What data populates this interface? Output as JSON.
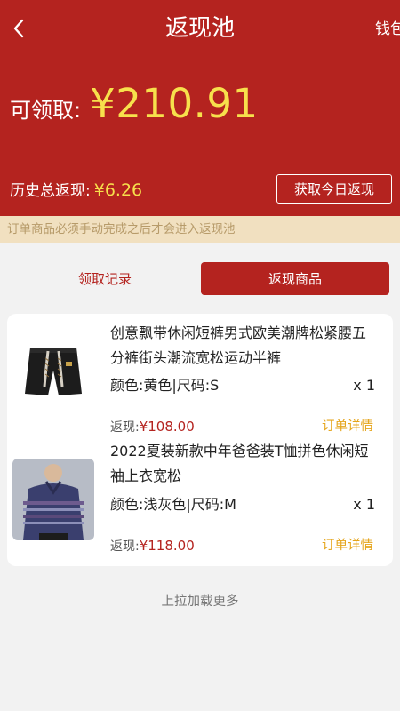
{
  "header": {
    "title": "返现池",
    "right_label": "钱包"
  },
  "summary": {
    "available_label": "可领取:",
    "available_amount": "¥210.91",
    "history_label": "历史总返现:",
    "history_amount": "¥6.26",
    "today_button": "获取今日返现"
  },
  "notice": "订单商品必须手动完成之后才会进入返现池",
  "tabs": [
    {
      "label": "领取记录",
      "active": false
    },
    {
      "label": "返现商品",
      "active": true
    }
  ],
  "products": [
    {
      "title": "创意飘带休闲短裤男式欧美潮牌松紧腰五分裤街头潮流宽松运动半裤",
      "spec": "颜色:黄色|尺码:S",
      "qty": "x 1",
      "rebate_label": "返现:",
      "rebate_value": "¥108.00",
      "detail_link": "订单详情"
    },
    {
      "title": "2022夏装新款中年爸爸装T恤拼色休闲短袖上衣宽松",
      "spec": "颜色:浅灰色|尺码:M",
      "qty": "x 1",
      "rebate_label": "返现:",
      "rebate_value": "¥118.00",
      "detail_link": "订单详情"
    }
  ],
  "footer": {
    "load_more": "上拉加载更多"
  },
  "colors": {
    "primary_red": "#b4231f",
    "amount_yellow": "#f7e04c",
    "link_orange": "#e5a51c",
    "notice_bg": "#f1e0c0"
  },
  "icons": {
    "back": "chevron-left-icon"
  }
}
